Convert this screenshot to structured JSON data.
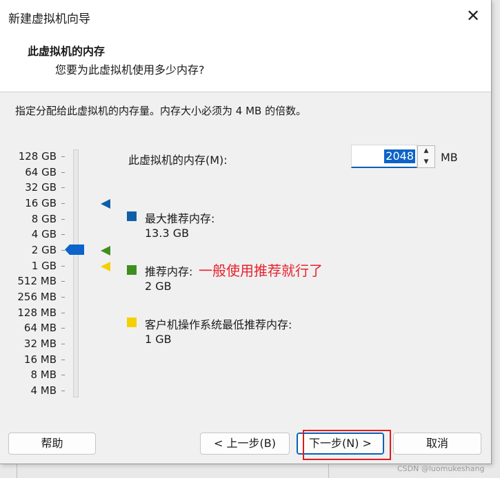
{
  "window": {
    "title": "新建虚拟机向导",
    "close_glyph": "✕"
  },
  "header": {
    "title": "此虚拟机的内存",
    "subtitle": "您要为此虚拟机使用多少内存?"
  },
  "description": "指定分配给此虚拟机的内存量。内存大小必须为 4 MB 的倍数。",
  "scale": [
    "128 GB",
    "64 GB",
    "32 GB",
    "16 GB",
    "8 GB",
    "4 GB",
    "2 GB",
    "1 GB",
    "512 MB",
    "256 MB",
    "128 MB",
    "64 MB",
    "32 MB",
    "16 MB",
    "8 MB",
    "4 MB"
  ],
  "memory": {
    "label": "此虚拟机的内存(M):",
    "value": "2048",
    "unit": "MB",
    "up_glyph": "▲",
    "down_glyph": "▼"
  },
  "legend": [
    {
      "name": "max",
      "title": "最大推荐内存:",
      "value": "13.3 GB",
      "color": "#0f5fa8"
    },
    {
      "name": "recommended",
      "title": "推荐内存:",
      "value": "2 GB",
      "color": "#3f8f1f"
    },
    {
      "name": "guest-min",
      "title": "客户机操作系统最低推荐内存:",
      "value": "1 GB",
      "color": "#f5d000"
    }
  ],
  "annotation": "一般使用推荐就行了",
  "markers": [
    {
      "name": "max",
      "color": "#0f5fa8",
      "level": "16 GB"
    },
    {
      "name": "recommended",
      "color": "#3f8f1f",
      "level": "2 GB"
    },
    {
      "name": "guest-min",
      "color": "#f5d000",
      "level": "1 GB"
    }
  ],
  "current_level": "2 GB",
  "buttons": {
    "help": "帮助",
    "back": "< 上一步(B)",
    "next": "下一步(N) >",
    "cancel": "取消"
  },
  "watermark": "CSDN @luomukeshang",
  "colors": {
    "accent": "#0a5fb5",
    "annotation": "#e8212c",
    "highlight_box": "#e01a1a"
  }
}
